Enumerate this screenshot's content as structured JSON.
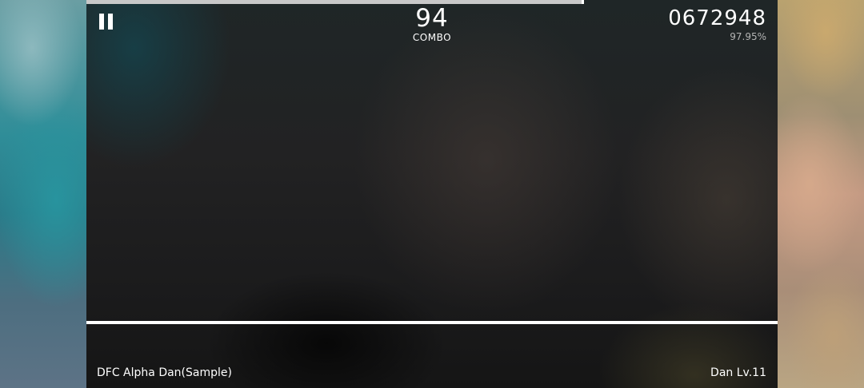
{
  "hud": {
    "progress": 0.72,
    "combo": "94",
    "combo_label": "COMBO",
    "score": "0672948",
    "accuracy": "97.95%"
  },
  "footer": {
    "song_title": "DFC Alpha Dan(Sample)",
    "level": "Dan Lv.11"
  },
  "icons": {
    "pause": "pause-icon"
  }
}
